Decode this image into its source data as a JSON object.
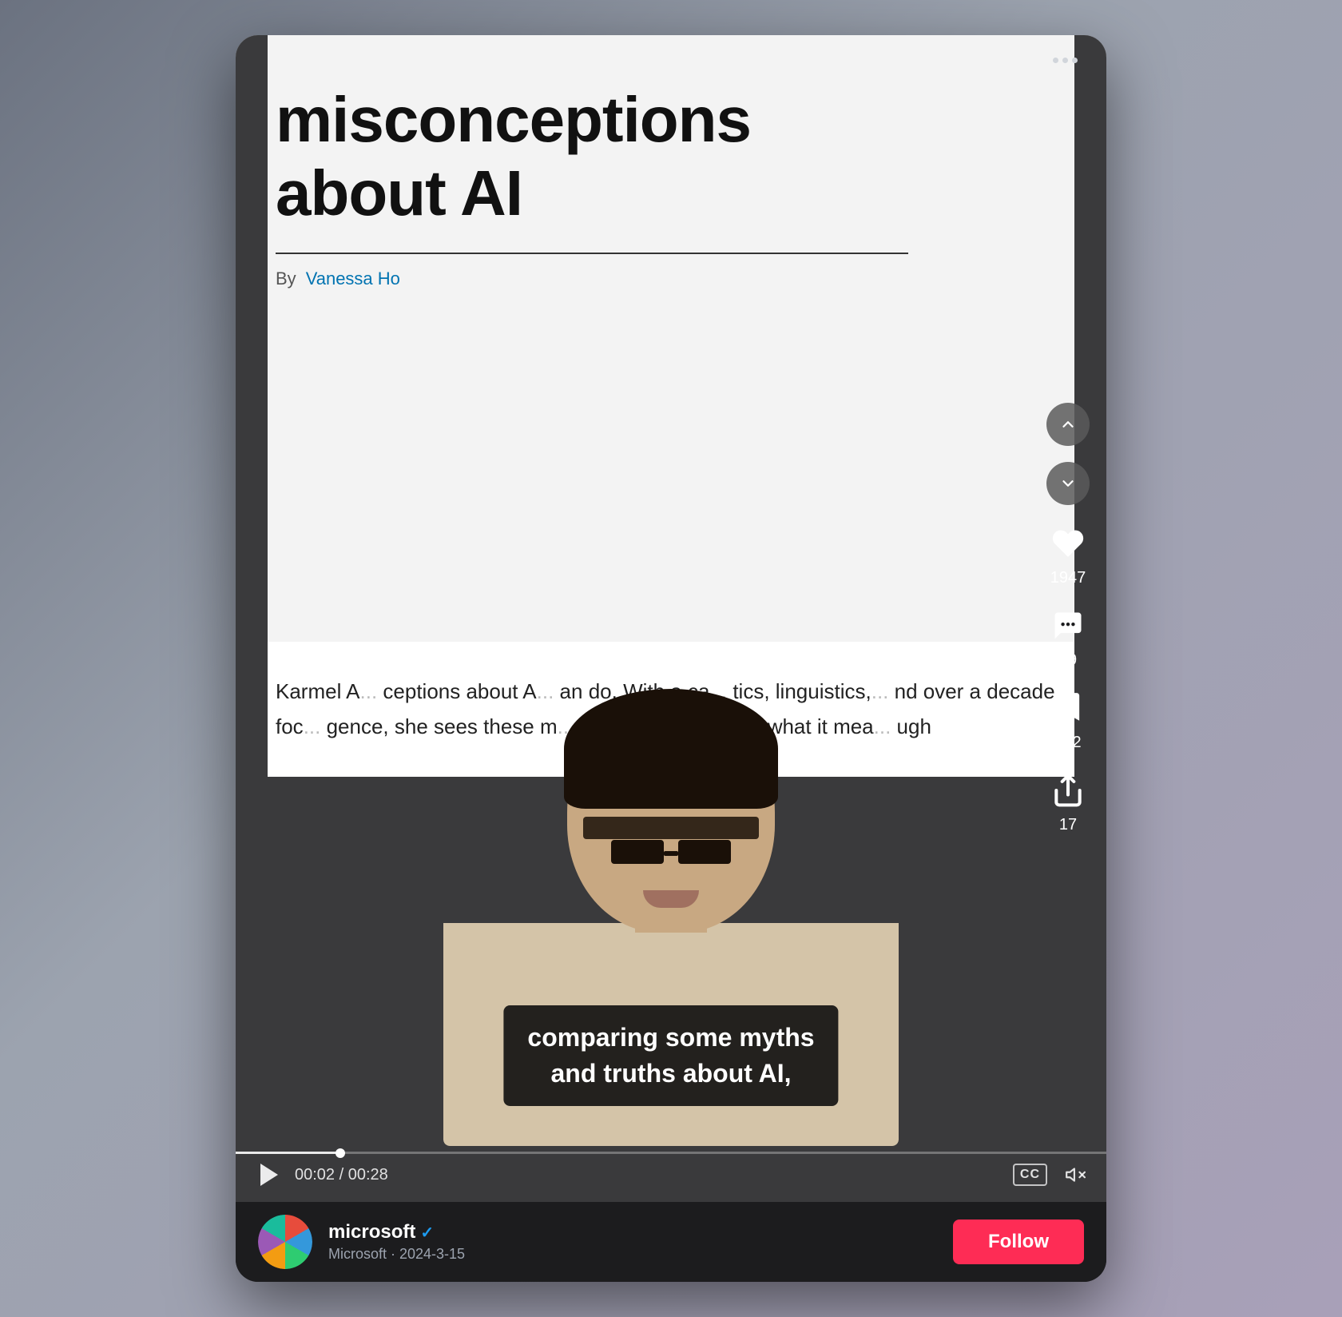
{
  "card": {
    "dots_label": "more options"
  },
  "article": {
    "title": "misconceptions\nabout AI",
    "by_label": "By",
    "author": "Vanessa Ho",
    "body_text": "Karmel A... ceptions about A... an do. With a ca... tics, linguistics, ... nd over a decade foc... gence, she sees these m... opportunities... s on what it mea... ugh"
  },
  "subtitle": {
    "line1": "comparing some myths",
    "line2": "and truths about AI,"
  },
  "controls": {
    "time": "00:02 / 00:28",
    "cc_label": "CC",
    "progress_pct": 12
  },
  "actions": {
    "like_count": "1947",
    "comment_count": "49",
    "bookmark_count": "242",
    "share_count": "17"
  },
  "account": {
    "name": "microsoft",
    "meta": "Microsoft · 2024-3-15",
    "follow_label": "Follow"
  }
}
